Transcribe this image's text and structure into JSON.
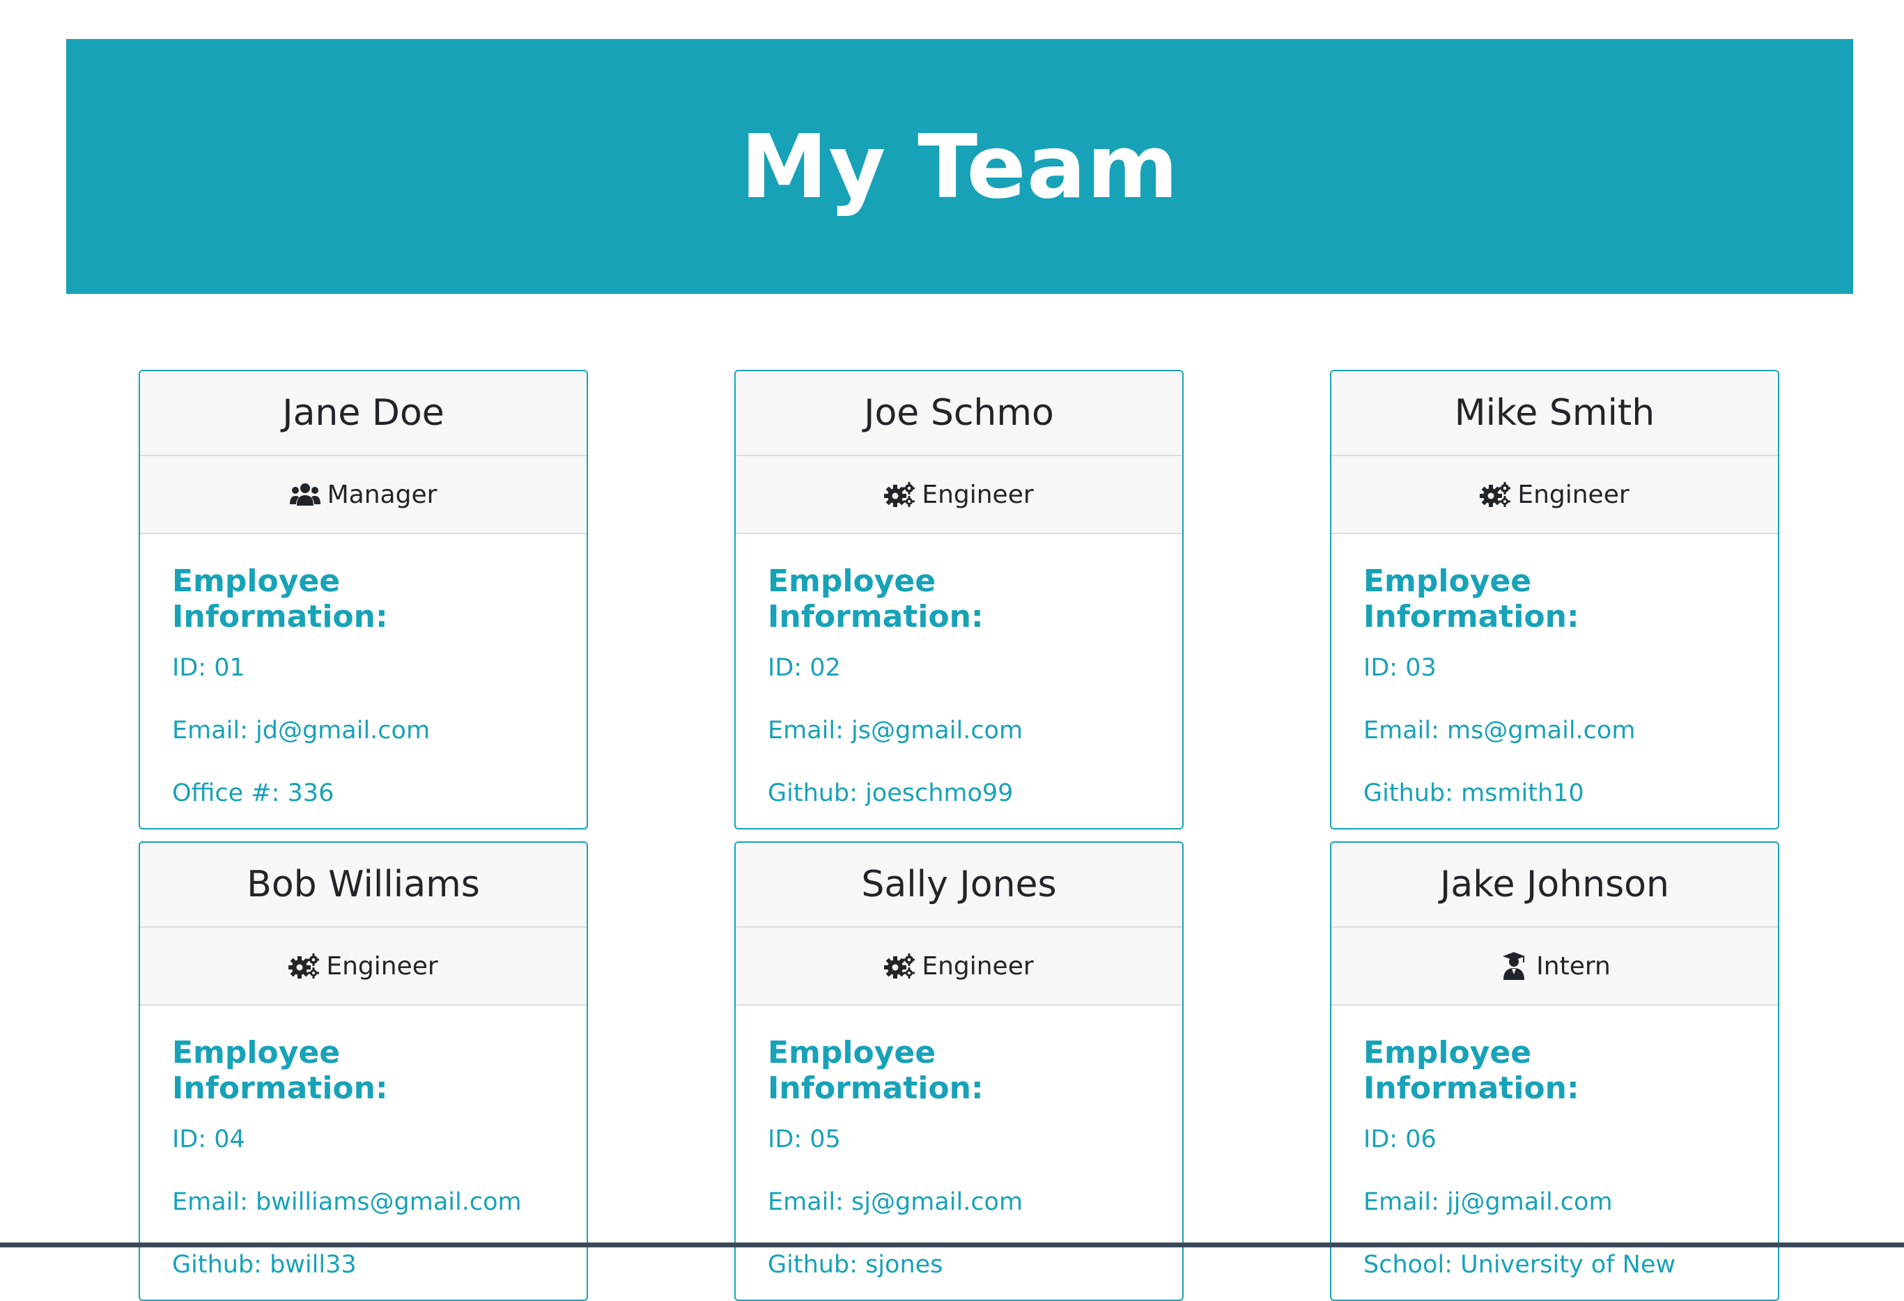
{
  "header": {
    "title": "My Team"
  },
  "info_heading": "Employee Information:",
  "cards": [
    {
      "name": "Jane Doe",
      "role": "Manager",
      "role_icon": "users-icon",
      "id": "ID: 01",
      "email": "Email: jd@gmail.com",
      "extra": "Office #: 336"
    },
    {
      "name": "Joe Schmo",
      "role": "Engineer",
      "role_icon": "cogs-icon",
      "id": "ID: 02",
      "email": "Email: js@gmail.com",
      "extra": "Github: joeschmo99"
    },
    {
      "name": "Mike Smith",
      "role": "Engineer",
      "role_icon": "cogs-icon",
      "id": "ID: 03",
      "email": "Email: ms@gmail.com",
      "extra": "Github: msmith10"
    },
    {
      "name": "Bob Williams",
      "role": "Engineer",
      "role_icon": "cogs-icon",
      "id": "ID: 04",
      "email": "Email: bwilliams@gmail.com",
      "extra": "Github: bwill33"
    },
    {
      "name": "Sally Jones",
      "role": "Engineer",
      "role_icon": "cogs-icon",
      "id": "ID: 05",
      "email": "Email: sj@gmail.com",
      "extra": "Github: sjones"
    },
    {
      "name": "Jake Johnson",
      "role": "Intern",
      "role_icon": "graduate-icon",
      "id": "ID: 06",
      "email": "Email: jj@gmail.com",
      "extra": "School: University of New"
    }
  ],
  "colors": {
    "accent": "#17a2b8",
    "card_head_bg": "#f7f7f7",
    "text_dark": "#212529"
  }
}
